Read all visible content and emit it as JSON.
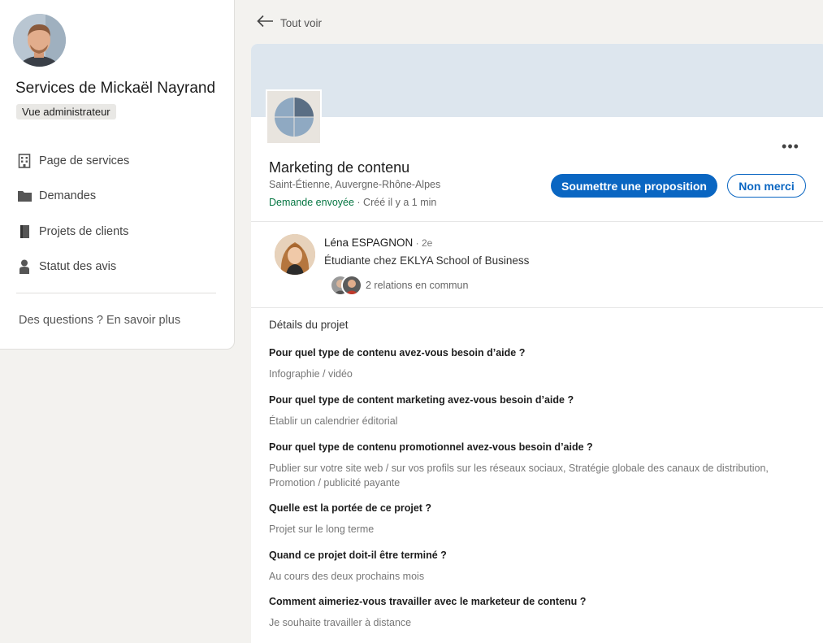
{
  "sidebar": {
    "title": "Services de Mickaël Nayrand",
    "badge": "Vue administrateur",
    "items": [
      {
        "label": "Page de services",
        "icon": "building-icon"
      },
      {
        "label": "Demandes",
        "icon": "folder-icon"
      },
      {
        "label": "Projets de clients",
        "icon": "notebook-icon"
      },
      {
        "label": "Statut des avis",
        "icon": "person-icon"
      }
    ],
    "help": "Des questions ? En savoir plus"
  },
  "back": {
    "label": "Tout voir",
    "icon": "arrow-left-icon"
  },
  "service": {
    "title": "Marketing de contenu",
    "location": "Saint-Étienne, Auvergne-Rhône-Alpes",
    "status": "Demande envoyée",
    "created": " · Créé il y a 1 min",
    "primary_button": "Soumettre une proposition",
    "secondary_button": "Non merci",
    "more_icon": "more-horizontal-icon"
  },
  "person": {
    "name": "Léna ESPAGNON",
    "degree": " · 2e",
    "headline": "Étudiante chez EKLYA School of Business",
    "mutual": "2 relations en commun"
  },
  "details": {
    "title": "Détails du projet",
    "items": [
      {
        "question": "Pour quel type de contenu avez-vous besoin d’aide ?",
        "answer": "Infographie / vidéo"
      },
      {
        "question": "Pour quel type de content marketing avez-vous besoin d’aide ?",
        "answer": "Établir un calendrier éditorial"
      },
      {
        "question": "Pour quel type de contenu promotionnel avez-vous besoin d’aide ?",
        "answer": "Publier sur votre site web / sur vos profils sur les réseaux sociaux, Stratégie globale des canaux de distribution, Promotion / publicité payante"
      },
      {
        "question": "Quelle est la portée de ce projet ?",
        "answer": "Projet sur le long terme"
      },
      {
        "question": "Quand ce projet doit-il être terminé ?",
        "answer": "Au cours des deux prochains mois"
      },
      {
        "question": "Comment aimeriez-vous travailler avec le marketeur de contenu ?",
        "answer": "Je souhaite travailler à distance"
      }
    ]
  },
  "colors": {
    "primary": "#0a66c2",
    "success": "#057642",
    "banner": "#dde6ee",
    "background": "#f3f2ef"
  }
}
